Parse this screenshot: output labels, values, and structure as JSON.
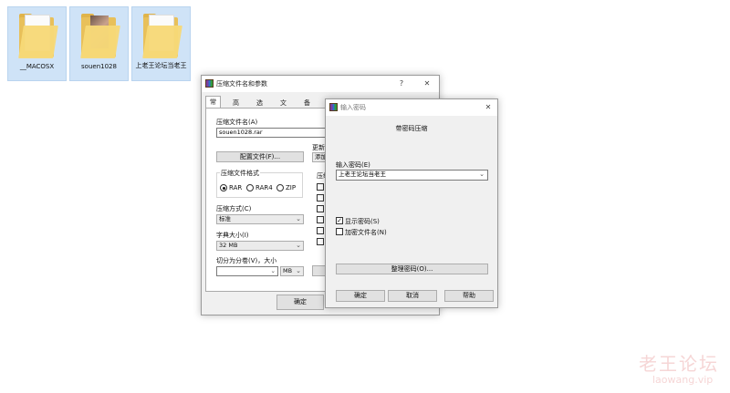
{
  "desktop": {
    "folders": [
      {
        "label": "__MACOSX"
      },
      {
        "label": "souen1028"
      },
      {
        "label": "上老王论坛当老王"
      }
    ],
    "watermark": {
      "title": "老王论坛",
      "subtitle": "laowang.vip"
    }
  },
  "main_dialog": {
    "title": "压缩文件名和参数",
    "help_btn": "?",
    "close_btn": "✕",
    "tabs": [
      "常规",
      "高级",
      "选项",
      "文件",
      "备份"
    ],
    "archive_name_label": "压缩文件名(A)",
    "archive_name_value": "souen1028.rar",
    "profiles_button": "配置文件(F)...",
    "update_label": "更新",
    "update_value": "添加",
    "format_group_label": "压缩文件格式",
    "formats": [
      "RAR",
      "RAR4",
      "ZIP"
    ],
    "options_group_label": "压缩",
    "method_label": "压缩方式(C)",
    "method_value": "标准",
    "dict_label": "字典大小(I)",
    "dict_value": "32 MB",
    "split_label": "切分为分卷(V)，大小",
    "split_unit": "MB",
    "ok_button": "确定"
  },
  "password_dialog": {
    "title": "输入密码",
    "close_btn": "✕",
    "heading": "带密码压缩",
    "password_label": "输入密码(E)",
    "password_value": "上老王论坛当老王",
    "show_password_label": "显示密码(S)",
    "show_password_checked": true,
    "encrypt_names_label": "加密文件名(N)",
    "encrypt_names_checked": false,
    "organize_button": "整理密码(O)...",
    "ok_button": "确定",
    "cancel_button": "取消",
    "help_button": "帮助"
  }
}
